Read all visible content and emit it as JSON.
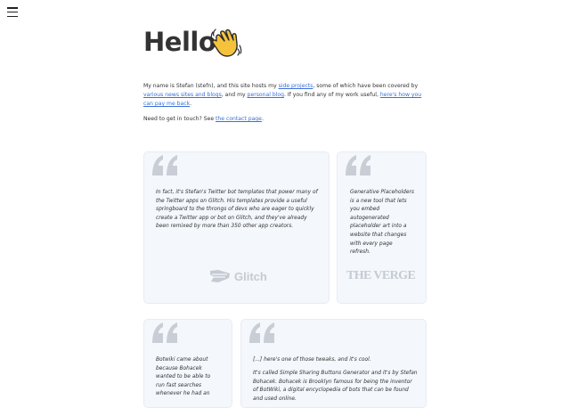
{
  "nav": {
    "menu_icon": "hamburger-icon"
  },
  "header": {
    "title": "Hello",
    "emoji": "waving-hand"
  },
  "intro": {
    "part1": "My name is Stefan (stefn), and this site hosts my ",
    "link_side_projects": "side projects",
    "part2": ", some of which have been covered by ",
    "link_news": "various news sites and blogs",
    "part3": ", and my ",
    "link_blog": "personal blog",
    "part4": ". If you find any of my work useful, ",
    "link_pay": "here's how you can pay me back",
    "part5": "."
  },
  "contact": {
    "text": "Need to get in touch? See ",
    "link": "the contact page",
    "end": "."
  },
  "testimonials": [
    {
      "quote": "In fact, it's Stefan's Twitter bot templates that power many of the Twitter apps on Glitch. His templates provide a useful springboard to the throngs of devs who are eager to quickly create a Twitter app or bot on Glitch, and they've already been remixed by more than 350 other app creators.",
      "source": "Glitch"
    },
    {
      "quote": "Generative Placeholders is a new tool that lets you embed autogenerated placeholder art into a website that changes with every page refresh.",
      "source": "THE VERGE"
    },
    {
      "quote": "Botwiki came about because Bohacek wanted to be able to run fast searches whenever he had an",
      "source": ""
    },
    {
      "quote": "[...] here's one of those tweaks, and it's cool.",
      "quote2": "It's called Simple Sharing Buttons Generator and it's by Stefan Bohacek. Bohacek is Brooklyn famous for being the inventor of BotWiki, a digital encyclopedia of bots that can be found and used online.",
      "source": ""
    }
  ],
  "colors": {
    "link": "#3a6fd8",
    "card_bg": "#f4f7fb",
    "quote_mark": "#c9ced6",
    "logo": "#c5cbd3"
  }
}
